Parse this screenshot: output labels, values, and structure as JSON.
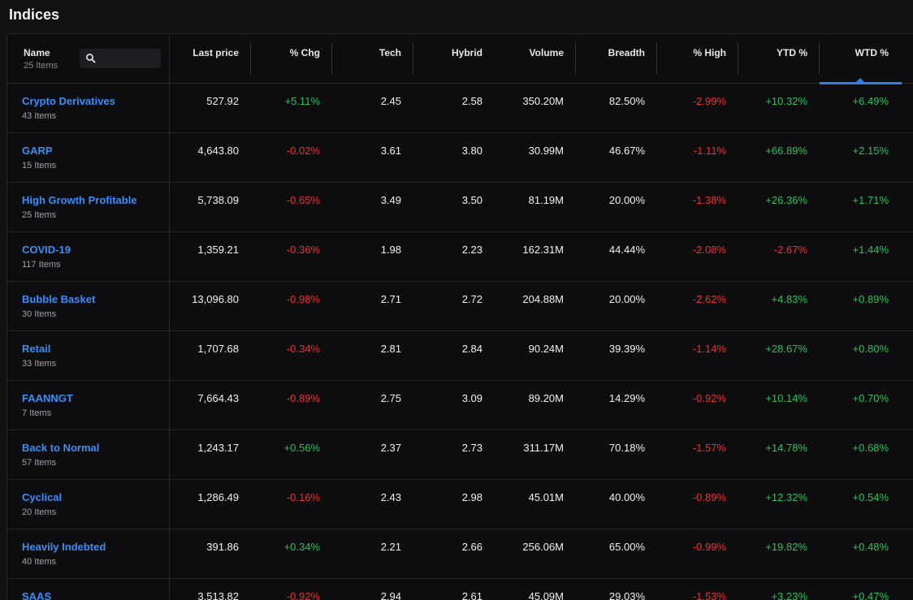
{
  "title": "Indices",
  "header": {
    "name_label": "Name",
    "name_count": "25 Items",
    "search_placeholder": "",
    "columns": [
      "Last price",
      "% Chg",
      "Tech",
      "Hybrid",
      "Volume",
      "Breadth",
      "% High",
      "YTD %",
      "WTD %"
    ],
    "sorted_column": "WTD %",
    "accent_color": "#2f7fe8"
  },
  "rows": [
    {
      "name": "Crypto Derivatives",
      "count": "43 Items",
      "last": "527.92",
      "chg": "+5.11%",
      "tech": "2.45",
      "hybrid": "2.58",
      "volume": "350.20M",
      "breadth": "82.50%",
      "high": "-2.99%",
      "ytd": "+10.32%",
      "wtd": "+6.49%"
    },
    {
      "name": "GARP",
      "count": "15 Items",
      "last": "4,643.80",
      "chg": "-0.02%",
      "tech": "3.61",
      "hybrid": "3.80",
      "volume": "30.99M",
      "breadth": "46.67%",
      "high": "-1.11%",
      "ytd": "+66.89%",
      "wtd": "+2.15%"
    },
    {
      "name": "High Growth Profitable",
      "count": "25 Items",
      "last": "5,738.09",
      "chg": "-0.65%",
      "tech": "3.49",
      "hybrid": "3.50",
      "volume": "81.19M",
      "breadth": "20.00%",
      "high": "-1.38%",
      "ytd": "+26.36%",
      "wtd": "+1.71%"
    },
    {
      "name": "COVID-19",
      "count": "117 Items",
      "last": "1,359.21",
      "chg": "-0.36%",
      "tech": "1.98",
      "hybrid": "2.23",
      "volume": "162.31M",
      "breadth": "44.44%",
      "high": "-2.08%",
      "ytd": "-2.67%",
      "wtd": "+1.44%"
    },
    {
      "name": "Bubble Basket",
      "count": "30 Items",
      "last": "13,096.80",
      "chg": "-0.98%",
      "tech": "2.71",
      "hybrid": "2.72",
      "volume": "204.88M",
      "breadth": "20.00%",
      "high": "-2.62%",
      "ytd": "+4.83%",
      "wtd": "+0.89%"
    },
    {
      "name": "Retail",
      "count": "33 Items",
      "last": "1,707.68",
      "chg": "-0.34%",
      "tech": "2.81",
      "hybrid": "2.84",
      "volume": "90.24M",
      "breadth": "39.39%",
      "high": "-1.14%",
      "ytd": "+28.67%",
      "wtd": "+0.80%"
    },
    {
      "name": "FAANNGT",
      "count": "7 Items",
      "last": "7,664.43",
      "chg": "-0.89%",
      "tech": "2.75",
      "hybrid": "3.09",
      "volume": "89.20M",
      "breadth": "14.29%",
      "high": "-0.92%",
      "ytd": "+10.14%",
      "wtd": "+0.70%"
    },
    {
      "name": "Back to Normal",
      "count": "57 Items",
      "last": "1,243.17",
      "chg": "+0.56%",
      "tech": "2.37",
      "hybrid": "2.73",
      "volume": "311.17M",
      "breadth": "70.18%",
      "high": "-1.57%",
      "ytd": "+14.78%",
      "wtd": "+0.68%"
    },
    {
      "name": "Cyclical",
      "count": "20 Items",
      "last": "1,286.49",
      "chg": "-0.16%",
      "tech": "2.43",
      "hybrid": "2.98",
      "volume": "45.01M",
      "breadth": "40.00%",
      "high": "-0.89%",
      "ytd": "+12.32%",
      "wtd": "+0.54%"
    },
    {
      "name": "Heavily Indebted",
      "count": "40 Items",
      "last": "391.86",
      "chg": "+0.34%",
      "tech": "2.21",
      "hybrid": "2.66",
      "volume": "256.06M",
      "breadth": "65.00%",
      "high": "-0.99%",
      "ytd": "+19.82%",
      "wtd": "+0.48%"
    },
    {
      "name": "SAAS",
      "count": "",
      "last": "3,513.82",
      "chg": "-0.92%",
      "tech": "2.94",
      "hybrid": "2.61",
      "volume": "45.09M",
      "breadth": "29.03%",
      "high": "-1.53%",
      "ytd": "+3.23%",
      "wtd": "+0.47%"
    }
  ]
}
